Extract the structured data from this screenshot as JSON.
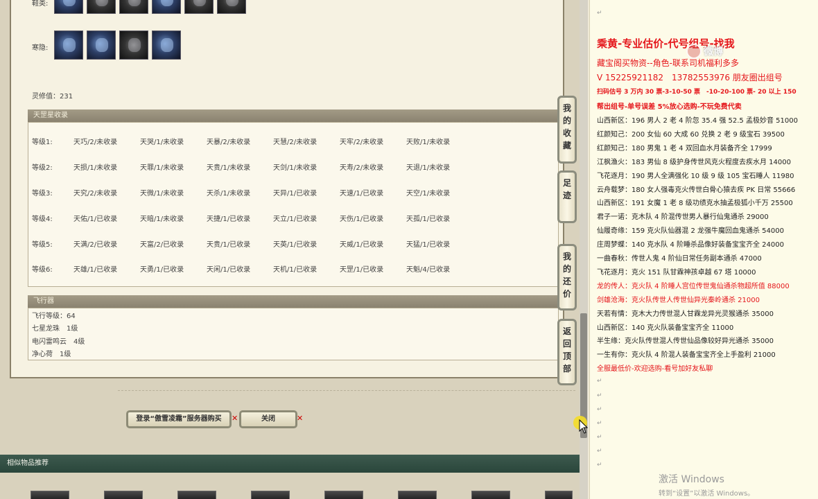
{
  "left": {
    "row_top_label": "鞋类:",
    "row_hidden_label": "寒隐:",
    "spirit_value": "灵修值：231",
    "tian_section": {
      "header": "天罡星收录",
      "rows": [
        {
          "label": "等级1:",
          "cells": [
            "天巧/2/未收录",
            "天哭/1/未收录",
            "天暴/2/未收录",
            "天慧/2/未收录",
            "天牢/2/未收录",
            "天败/1/未收录"
          ]
        },
        {
          "label": "等级2:",
          "cells": [
            "天损/1/未收录",
            "天罪/1/未收录",
            "天贵/1/未收录",
            "天剑/1/未收录",
            "天寿/2/未收录",
            "天退/1/未收录"
          ]
        },
        {
          "label": "等级3:",
          "cells": [
            "天究/2/未收录",
            "天微/1/未收录",
            "天杀/1/未收录",
            "天异/1/已收录",
            "天速/1/已收录",
            "天空/1/未收录"
          ]
        },
        {
          "label": "等级4:",
          "cells": [
            "天佑/1/已收录",
            "天暗/1/未收录",
            "天捷/1/已收录",
            "天立/1/已收录",
            "天伤/1/已收录",
            "天孤/1/已收录"
          ]
        },
        {
          "label": "等级5:",
          "cells": [
            "天满/2/已收录",
            "天富/2/已收录",
            "天贵/1/已收录",
            "天英/1/已收录",
            "天威/1/已收录",
            "天猛/1/已收录"
          ]
        },
        {
          "label": "等级6:",
          "cells": [
            "天雄/1/已收录",
            "天勇/1/已收录",
            "天闲/1/已收录",
            "天机/1/已收录",
            "天罡/1/已收录",
            "天魁/4/已收录"
          ]
        }
      ]
    },
    "fly_section": {
      "header": "飞行器",
      "lines": [
        "飞行等级：64",
        "七星龙珠　1级",
        "电闪雷鸣云　4级",
        "净心荷　1级"
      ]
    },
    "side_tabs": [
      "我的收藏",
      "足迹",
      "我的还价",
      "返回顶部"
    ],
    "buy_button": "登录“傲雪凌霜”服务器购买",
    "close_button": "关闭",
    "similar_title": "相似物品推荐"
  },
  "doc": {
    "title": "乘黄-专业估价-代号组号-找我",
    "subtitle": "藏宝阁买物资--角色-联系司机福利多多",
    "contact": "V 15225921182　13782553976 朋友圈出组号",
    "promo1": "扫码估号 3 万内 30 票-3-10-50 票　-10-20-100 票- 20 以上 150",
    "promo2": "帮出组号-单号误差 5%放心选购-不玩免费代卖",
    "listings": [
      {
        "text": "山西新区：196 男人 2 老 4 阶忽 35.4 强 52.5 孟极妙音 51000",
        "red": false
      },
      {
        "text": "红颜知己：200 女仙 60 大成 60 兑换 2 老 9 级宝石 39500",
        "red": false
      },
      {
        "text": "红颜知己：180 男鬼 1 老 4 双回血水月装备齐全 17999",
        "red": false
      },
      {
        "text": "江枫渔火：183 男仙 8 级护身传世风克火程度去疾水月 14000",
        "red": false
      },
      {
        "text": "飞花逐月：190 男人全满强化 10 级 9 级 105 宝石睡人 11980",
        "red": false
      },
      {
        "text": "云舟载梦：180 女人强毒克火传世白骨心猿去疾 PK 日常 55666",
        "red": false
      },
      {
        "text": "山西新区：191 女魔 1 老 8 级功绩克水抽孟极狐小千万 25500",
        "red": false
      },
      {
        "text": "君子一诺：克木队 4 阶混传世男人暴行仙鬼通杀 29000",
        "red": false
      },
      {
        "text": "仙履奇缘：159 克火队仙器混 2 龙强牛魔回血鬼通杀 54000",
        "red": false
      },
      {
        "text": "庄周梦蝶：140 克水队 4 阶睡杀品像好装备宝宝齐全 24000",
        "red": false
      },
      {
        "text": "一曲春秋：传世人鬼 4 阶仙日常任务副本通杀 47000",
        "red": false
      },
      {
        "text": "飞花逐月：克火 151 队甘霖神孩卓越 67 塔 10000",
        "red": false
      },
      {
        "text": "龙的传人：克火队 4 阶睡人宫位传世鬼仙通杀物超所值 88000",
        "red": true
      },
      {
        "text": "剑雄沧海：克火队传世人传世仙异光秦岭通杀 21000",
        "red": true
      },
      {
        "text": "天若有情：克木大力传世混人甘霖龙异光灵猴通杀 35000",
        "red": false
      },
      {
        "text": "山西新区：140 克火队装备宝宝齐全 11000",
        "red": false
      },
      {
        "text": "半生缘：克火队传世混人传世仙品像较好异光通杀 35000",
        "red": false
      },
      {
        "text": "一生有你：克火队 4 阶混人装备宝宝齐全上手盈利 21000",
        "red": false
      }
    ],
    "footer": "全服最低价-欢迎选购-看号加好友私聊",
    "watermark": "微博",
    "activate_title": "激活 Windows",
    "activate_sub": "转到“设置”以激活 Windows。"
  }
}
